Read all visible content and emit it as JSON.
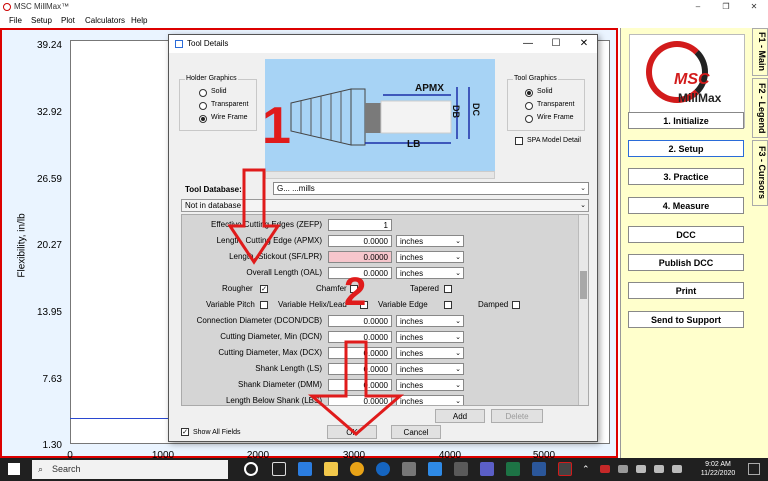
{
  "app": {
    "title": "MSC MillMax™",
    "window_controls": [
      "–",
      "❐",
      "✕"
    ]
  },
  "menu": [
    "File",
    "Setup",
    "Plot",
    "Calculators",
    "Help"
  ],
  "chart_data": {
    "type": "line",
    "ylabel": "Flexibility, in/lb",
    "xlabel": "",
    "y_ticks": [
      "39.24",
      "32.92",
      "26.59",
      "20.27",
      "13.95",
      "7.63",
      "1.30"
    ],
    "x_ticks": [
      "0",
      "1000",
      "2000",
      "3000",
      "4000",
      "5000"
    ],
    "ylim": [
      1.3,
      39.24
    ],
    "xlim": [
      0,
      5000
    ],
    "series": [
      {
        "x": [
          0,
          800
        ],
        "y": [
          4.5,
          4.6
        ]
      }
    ]
  },
  "right_panel": {
    "logo_text": "MSC",
    "logo_sub": "MillMax",
    "buttons": [
      "1. Initialize",
      "2. Setup",
      "3. Practice",
      "4. Measure",
      "DCC",
      "Publish DCC",
      "Print",
      "Send to Support"
    ],
    "active_index": 1,
    "side_tabs": [
      "F1 - Main",
      "F2 - Legend",
      "F3 - Cursors"
    ]
  },
  "dialog": {
    "title": "Tool Details",
    "controls": [
      "—",
      "☐",
      "✕"
    ],
    "holder_graphics": {
      "label": "Holder Graphics",
      "options": [
        "Solid",
        "Transparent",
        "Wire Frame"
      ],
      "selected": 2
    },
    "tool_graphics": {
      "label": "Tool Graphics",
      "options": [
        "Solid",
        "Transparent",
        "Wire Frame"
      ],
      "selected": 0,
      "spa_label": "SPA Model Detail"
    },
    "preview_labels": {
      "apmx": "APMX",
      "lb": "LB",
      "db": "DB",
      "dc": "DC"
    },
    "tool_database_label": "Tool Database:",
    "tool_database_value": "G... ...mills",
    "not_in_db": "Not in database",
    "rows": [
      {
        "label": "Effective Cutting Edges (ZEFP)",
        "value": "1",
        "unit": ""
      },
      {
        "label": "Length, Cutting Edge (APMX)",
        "value": "0.0000",
        "unit": "inches"
      },
      {
        "label": "Length, Stickout (SF/LPR)",
        "value": "0.0000",
        "unit": "inches",
        "highlight": true
      },
      {
        "label": "Overall Length (OAL)",
        "value": "0.0000",
        "unit": "inches"
      },
      {
        "label": "Connection Diameter (DCON/DCB)",
        "value": "0.0000",
        "unit": "inches"
      },
      {
        "label": "Cutting Diameter, Min (DCN)",
        "value": "0.0000",
        "unit": "inches"
      },
      {
        "label": "Cutting Diameter, Max (DCX)",
        "value": "0.0000",
        "unit": "inches"
      },
      {
        "label": "Shank Length (LS)",
        "value": "0.0000",
        "unit": "inches"
      },
      {
        "label": "Shank Diameter (DMM)",
        "value": "0.0000",
        "unit": "inches"
      },
      {
        "label": "Length Below Shank (LBS)",
        "value": "0.0000",
        "unit": "inches"
      }
    ],
    "checks_row1": [
      {
        "label": "Rougher",
        "checked": true
      },
      {
        "label": "Chamfer",
        "checked": false
      },
      {
        "label": "Tapered",
        "checked": false
      }
    ],
    "checks_row2": [
      {
        "label": "Variable Pitch",
        "checked": false
      },
      {
        "label": "Variable Helix/Lead",
        "checked": false
      },
      {
        "label": "Variable Edge",
        "checked": false
      },
      {
        "label": "Damped",
        "checked": false
      }
    ],
    "add_label": "Add",
    "delete_label": "Delete",
    "show_all_label": "Show All Fields",
    "ok_label": "OK",
    "cancel_label": "Cancel"
  },
  "annotations": {
    "one": "1",
    "two": "2"
  },
  "taskbar": {
    "search_placeholder": "Search",
    "time": "9:02 AM",
    "date": "11/22/2020"
  },
  "colors": {
    "accent": "#2a6bd8",
    "annotation": "#e01b1b",
    "highlight": "#f6c6cc"
  }
}
